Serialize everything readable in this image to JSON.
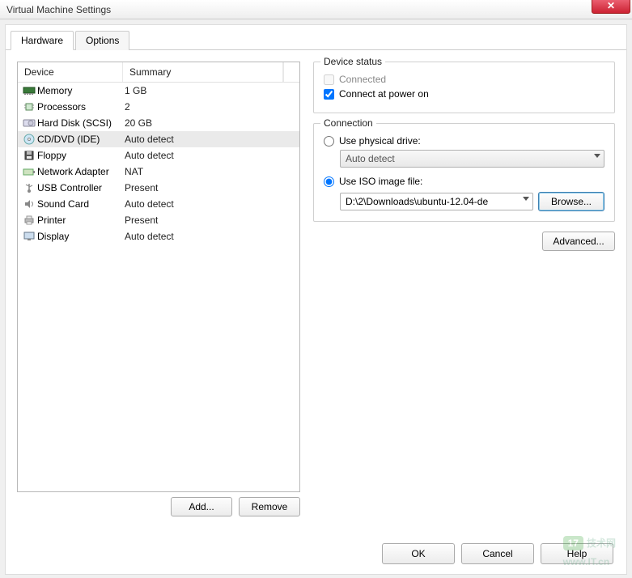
{
  "window": {
    "title": "Virtual Machine Settings",
    "close_tooltip": "Close"
  },
  "tabs": {
    "hardware": "Hardware",
    "options": "Options"
  },
  "deviceHeaders": {
    "device": "Device",
    "summary": "Summary"
  },
  "devices": [
    {
      "icon": "memory",
      "name": "Memory",
      "summary": "1 GB"
    },
    {
      "icon": "cpu",
      "name": "Processors",
      "summary": "2"
    },
    {
      "icon": "hdd",
      "name": "Hard Disk (SCSI)",
      "summary": "20 GB"
    },
    {
      "icon": "cd",
      "name": "CD/DVD (IDE)",
      "summary": "Auto detect"
    },
    {
      "icon": "floppy",
      "name": "Floppy",
      "summary": "Auto detect"
    },
    {
      "icon": "nic",
      "name": "Network Adapter",
      "summary": "NAT"
    },
    {
      "icon": "usb",
      "name": "USB Controller",
      "summary": "Present"
    },
    {
      "icon": "sound",
      "name": "Sound Card",
      "summary": "Auto detect"
    },
    {
      "icon": "printer",
      "name": "Printer",
      "summary": "Present"
    },
    {
      "icon": "display",
      "name": "Display",
      "summary": "Auto detect"
    }
  ],
  "selectedDevice": 3,
  "leftButtons": {
    "add": "Add...",
    "remove": "Remove"
  },
  "status": {
    "legend": "Device status",
    "connected": "Connected",
    "connectedChecked": false,
    "connectedEnabled": false,
    "connectAtPowerOn": "Connect at power on",
    "connectAtPowerOnChecked": true
  },
  "connection": {
    "legend": "Connection",
    "usePhysical": "Use physical drive:",
    "physicalSelected": "Auto detect",
    "useIso": "Use ISO image file:",
    "isoPath": "D:\\2\\Downloads\\ubuntu-12.04-de",
    "browse": "Browse...",
    "mode": "iso"
  },
  "advanced": "Advanced...",
  "footer": {
    "ok": "OK",
    "cancel": "Cancel",
    "help": "Help"
  },
  "watermark": {
    "logo": "17",
    "text": "技术网",
    "url": "www.IT.cn"
  }
}
